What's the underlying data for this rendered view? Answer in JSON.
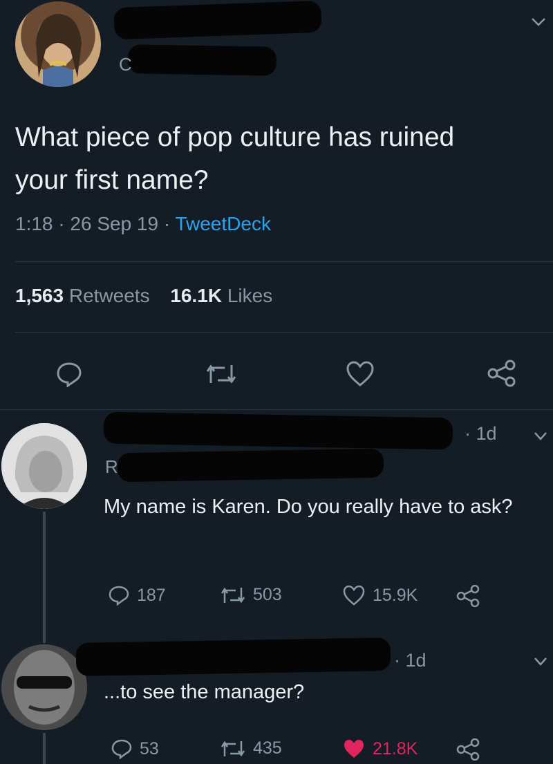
{
  "main_tweet": {
    "text": "What piece of pop culture has ruined your first name?",
    "time": "1:18",
    "date": "26 Sep 19",
    "source": "TweetDeck",
    "retweets_count": "1,563",
    "retweets_label": "Retweets",
    "likes_count": "16.1K",
    "likes_label": "Likes",
    "handle_fragment": "C"
  },
  "reply1": {
    "time_ago": "1d",
    "reply_to_fragment": "R",
    "text": "My name is Karen. Do you really have to ask?",
    "replies": "187",
    "retweets": "503",
    "likes": "15.9K"
  },
  "reply2": {
    "time_ago": "1d",
    "text": "...to see the manager?",
    "replies": "53",
    "retweets": "435",
    "likes": "21.8K",
    "liked_color": "#e0245e"
  }
}
